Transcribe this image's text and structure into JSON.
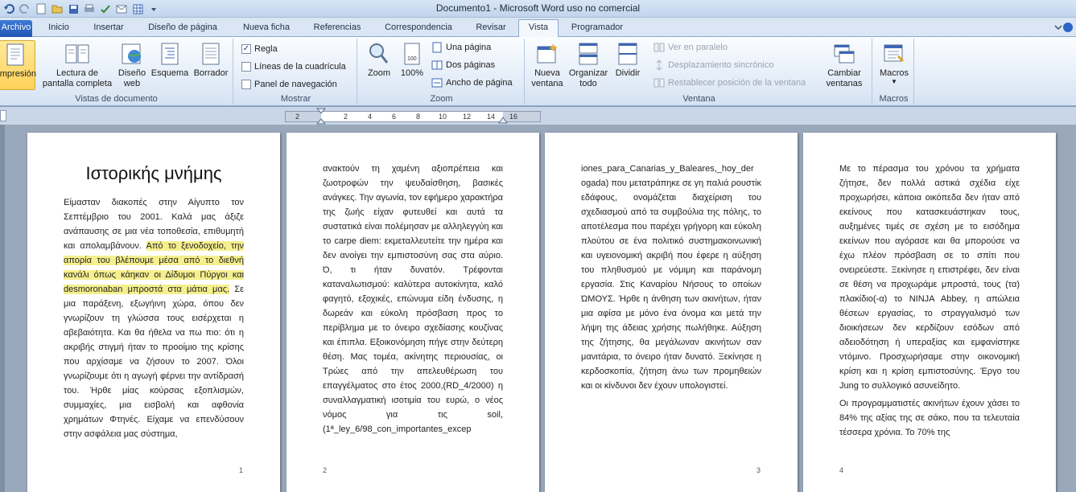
{
  "window": {
    "title": "Documento1  -  Microsoft Word uso no comercial"
  },
  "tabs": [
    "Archivo",
    "Inicio",
    "Insertar",
    "Diseño de página",
    "Nueva ficha",
    "Referencias",
    "Correspondencia",
    "Revisar",
    "Vista",
    "Programador"
  ],
  "active_tab": "Vista",
  "ribbon": {
    "views": {
      "label": "Vistas de documento",
      "print_layout": "Diseño de impresión",
      "full_screen_1": "Lectura de",
      "full_screen_2": "pantalla completa",
      "web_1": "Diseño",
      "web_2": "web",
      "outline": "Esquema",
      "draft": "Borrador"
    },
    "show": {
      "label": "Mostrar",
      "ruler": "Regla",
      "gridlines": "Líneas de la cuadrícula",
      "navpane": "Panel de navegación",
      "ruler_checked": true,
      "gridlines_checked": false,
      "navpane_checked": false
    },
    "zoom": {
      "label": "Zoom",
      "zoom": "Zoom",
      "pct": "100%",
      "one_page": "Una página",
      "two_pages": "Dos páginas",
      "page_width": "Ancho de página"
    },
    "window": {
      "label": "Ventana",
      "new_1": "Nueva",
      "new_2": "ventana",
      "arrange_1": "Organizar",
      "arrange_2": "todo",
      "split": "Dividir",
      "side_by_side": "Ver en paralelo",
      "sync_scroll": "Desplazamiento sincrónico",
      "reset_pos": "Restablecer posición de la ventana",
      "switch_1": "Cambiar",
      "switch_2": "ventanas"
    },
    "macros": {
      "label": "Macros",
      "macros": "Macros"
    }
  },
  "ruler": {
    "numbers": [
      "2",
      "2",
      "4",
      "6",
      "8",
      "10",
      "12",
      "14",
      "16"
    ]
  },
  "pages": [
    {
      "number": "1",
      "title": "Ιστορικής μνήμης",
      "text_a": "Είμασταν διακοπές στην Αίγυπτο τον Σεπτέμβριο του 2001. Καλά μας άξιζε ανάπαυσης σε μια νέα τοποθεσία, επιθυμητή και απολαμβάνουν. ",
      "text_hl": "Από το ξενοδοχείο, την απορία του βλέπουμε μέσα από το διεθνή κανάλι όπως κάηκαν οι Δίδυμοι Πύργοι και desmoronaban μπροστά στα μάτια μας.",
      "text_b": " Σε μια παράξενη, εξωγήινη χώρα, όπου δεν γνωρίζουν τη γλώσσα τους εισέρχεται η αβεβαιότητα. Και θα ήθελα να πω πιο: ότι η ακριβής στιγμή ήταν το προοίμιο της κρίσης που αρχίσαμε να ζήσουν το 2007. Όλοι γνωρίζουμε ότι η αγωγή φέρνει την αντίδρασή του. Ήρθε μίας κούρσας εξοπλισμών, συμμαχίες, μια εισβολή και αφθονία χρημάτων Φτηνές. Είχαμε να επενδύσουν στην ασφάλεια μας σύστημα,"
    },
    {
      "number": "2",
      "text": "ανακτούν τη χαμένη αξιοπρέπεια και ζωοτροφών την ψευδαίσθηση, βασικές ανάγκες. Την αγωνία, τον εφήμερο χαρακτήρα της ζωής είχαν φυτευθεί και αυτά τα συστατικά είναι πολέμησαν με αλληλεγγύη και το carpe diem: εκμεταλλευτείτε την ημέρα και δεν ανοίγει την εμπιστοσύνη σας στα αύριο. Ό, τι ήταν δυνατόν. Τρέφονται καταναλωτισμού: καλύτερα αυτοκίνητα, καλό φαγητό, εξοχικές, επώνυμα είδη ένδυσης, η δωρεάν και εύκολη πρόσβαση προς το περίβλημα με το όνειρο σχεδίασης κουζίνας και έπιπλα. Εξοικονόμηση πήγε στην δεύτερη θέση. Μας τομέα, ακίνητης περιουσίας, οι Τρώες από την απελευθέρωση του επαγγέλματος στο έτος 2000,(RD_4/2000) η συναλλαγματική ισοτιμία του ευρώ, ο νέος νόμος για τις soil,(1ª_ley_6/98_con_importantes_excep"
    },
    {
      "number": "3",
      "text": "iones_para_Canarias_y_Baleares,_hoy_der ogada) που μετατράπηκε σε γη παλιά ρουστίκ εδάφους, ονομάζεται διαχείριση του σχεδιασμού από τα συμβούλια της πόλης, το αποτέλεσμα που παρέχει γρήγορη και εύκολη πλούτου σε ένα πολιτικό συστημακοινωνική και υγειονομική ακριβή που έφερε η αύξηση του πληθυσμού με νόμιμη και παράνομη εργασία. Στις Καναρίου Νήσους το οποίων ΏΜΟΥΣ. Ήρθε η άνθηση των ακινήτων, ήταν μια αφίσα με μόνο ένα όνομα και μετά την λήψη της άδειας χρήσης πωλήθηκε. Αύξηση της ζήτησης, θα μεγάλωναν ακινήτων σαν μανιτάρια, το όνειρο ήταν δυνατό. Ξεκίνησε η κερδοσκοπία, ζήτηση άνω των προμηθειών και οι κίνδυνοι δεν έχουν υπολογιστεί."
    },
    {
      "number": "4",
      "text": "Με το πέρασμα του χρόνου τα χρήματα ζήτησε, δεν πολλά αστικά σχέδια είχε προχωρήσει, κάποια οικόπεδα δεν ήταν από εκείνους που κατασκευάστηκαν τους, αυξημένες τιμές σε σχέση με το εισόδημα εκείνων που αγόρασε και θα μπορούσε να έχω πλέον πρόσβαση σε το σπίτι που ονειρεύεστε. Ξεκίνησε η επιστρέφει, δεν είναι σε θέση να προχωράμε μπροστά, τους (τα) πλακίδιο(-α) το NINJA Abbey, η απώλεια θέσεων εργασίας, το στραγγαλισμό των διοικήσεων δεν κερδίζουν εσόδων από αδειοδότηση ή υπεραξίας και εμφανίστηκε ντόμινο. Προσχωρήσαμε στην οικονομική κρίση και η κρίση εμπιστοσύνης. Έργο του Jung το συλλογικό ασυνείδητο.",
      "text2": "Οι προγραμματιστές ακινήτων έχουν χάσει το 84% της αξίας της σε σάκο, που τα τελευταία τέσσερα χρόνια. Το 70% της"
    }
  ]
}
